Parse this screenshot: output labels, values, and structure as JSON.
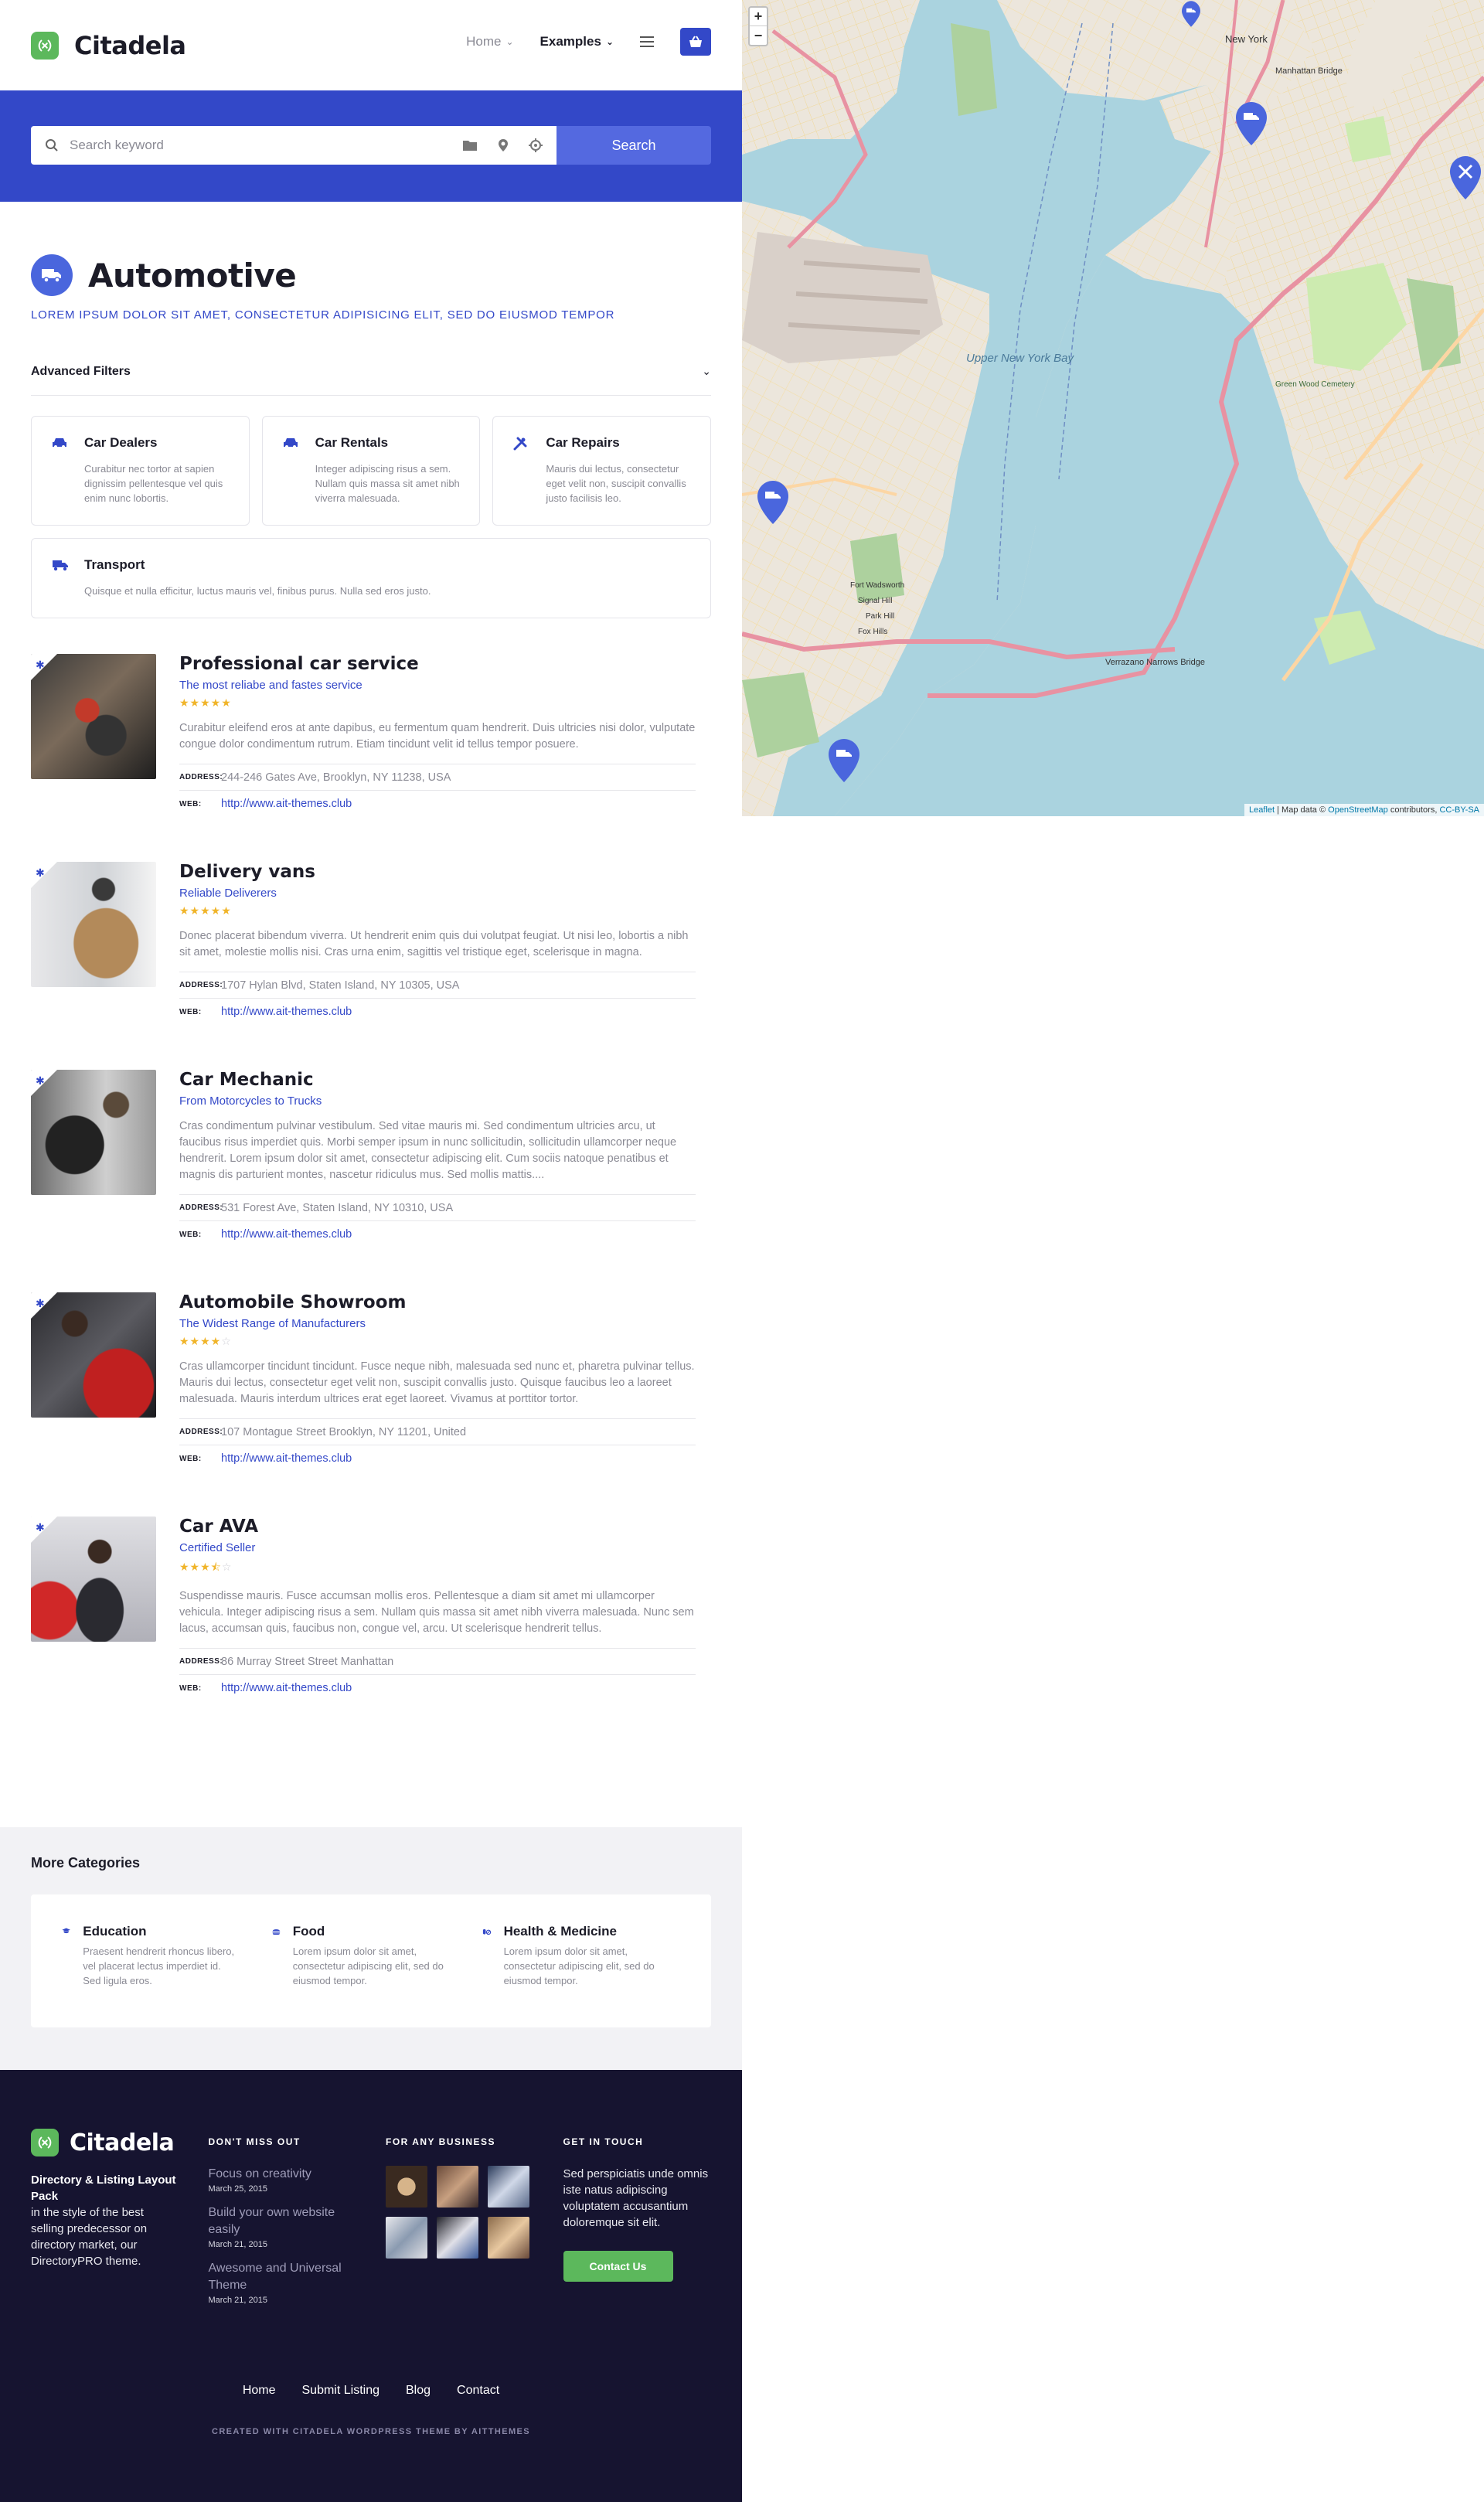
{
  "site": {
    "name": "Citadela"
  },
  "nav": {
    "home": "Home",
    "examples": "Examples"
  },
  "search": {
    "placeholder": "Search keyword",
    "button": "Search"
  },
  "category": {
    "title": "Automotive",
    "subtitle": "LOREM IPSUM DOLOR SIT AMET, CONSECTETUR ADIPISICING ELIT, SED DO EIUSMOD TEMPOR"
  },
  "filters": {
    "label": "Advanced Filters"
  },
  "subcategories": [
    {
      "title": "Car Dealers",
      "desc": "Curabitur nec tortor at sapien dignissim pellentesque vel quis enim nunc lobortis.",
      "icon": "car-icon"
    },
    {
      "title": "Car Rentals",
      "desc": "Integer adipiscing risus a sem. Nullam quis massa sit amet nibh viverra malesuada.",
      "icon": "car-icon"
    },
    {
      "title": "Car Repairs",
      "desc": "Mauris dui lectus, consectetur eget velit non, suscipit convallis justo facilisis leo.",
      "icon": "tools-icon"
    },
    {
      "title": "Transport",
      "desc": "Quisque et nulla efficitur, luctus mauris vel, finibus purus. Nulla sed eros justo.",
      "icon": "truck-icon"
    }
  ],
  "listings": [
    {
      "title": "Professional car service",
      "subtitle": "The most reliabe and fastes service",
      "rating": 5,
      "desc": "Curabitur eleifend eros at ante dapibus, eu fermentum quam hendrerit. Duis ultricies nisi dolor, vulputate congue dolor condimentum rutrum. Etiam tincidunt velit id tellus tempor posuere.",
      "address": "244-246 Gates Ave, Brooklyn, NY 11238, USA",
      "web": "http://www.ait-themes.club"
    },
    {
      "title": "Delivery vans",
      "subtitle": "Reliable Deliverers",
      "rating": 5,
      "desc": "Donec placerat bibendum viverra. Ut hendrerit enim quis dui volutpat feugiat. Ut nisi leo, lobortis a nibh sit amet, molestie mollis nisi. Cras urna enim, sagittis vel tristique eget, scelerisque in magna.",
      "address": "1707 Hylan Blvd, Staten Island, NY 10305, USA",
      "web": "http://www.ait-themes.club"
    },
    {
      "title": "Car Mechanic",
      "subtitle": "From Motorcycles to Trucks",
      "rating": 0,
      "desc": "Cras condimentum pulvinar vestibulum. Sed vitae mauris mi. Sed condimentum ultricies arcu, ut faucibus risus imperdiet quis. Morbi semper ipsum in nunc sollicitudin, sollicitudin ullamcorper neque hendrerit. Lorem ipsum dolor sit amet, consectetur adipiscing elit. Cum sociis natoque penatibus et magnis dis parturient montes, nascetur ridiculus mus. Sed mollis mattis....",
      "address": "531 Forest Ave, Staten Island, NY 10310, USA",
      "web": "http://www.ait-themes.club"
    },
    {
      "title": "Automobile Showroom",
      "subtitle": "The Widest Range of Manufacturers",
      "rating": 4,
      "desc": "Cras ullamcorper tincidunt tincidunt. Fusce neque nibh, malesuada sed nunc et, pharetra pulvinar tellus. Mauris dui lectus, consectetur eget velit non, suscipit convallis justo. Quisque faucibus leo a laoreet malesuada. Mauris interdum ultrices erat eget laoreet. Vivamus at porttitor tortor.",
      "address": "107 Montague Street Brooklyn, NY 11201, United",
      "web": "http://www.ait-themes.club"
    },
    {
      "title": "Car AVA",
      "subtitle": "Certified Seller",
      "rating": 3.5,
      "desc": "Suspendisse mauris. Fusce accumsan mollis eros. Pellentesque a diam sit amet mi ullamcorper vehicula. Integer adipiscing risus a sem. Nullam quis massa sit amet nibh viverra malesuada. Nunc sem lacus, accumsan quis, faucibus non, congue vel, arcu. Ut scelerisque hendrerit tellus.",
      "address": "86 Murray Street Street Manhattan",
      "web": "http://www.ait-themes.club"
    }
  ],
  "meta_labels": {
    "address": "ADDRESS:",
    "web": "WEB:"
  },
  "more": {
    "title": "More Categories",
    "items": [
      {
        "title": "Education",
        "desc": "Praesent hendrerit rhoncus libero, vel placerat lectus imperdiet id. Sed ligula eros.",
        "icon": "graduation-cap-icon"
      },
      {
        "title": "Food",
        "desc": "Lorem ipsum dolor sit amet, consectetur adipiscing elit, sed do eiusmod tempor.",
        "icon": "burger-icon"
      },
      {
        "title": "Health & Medicine",
        "desc": "Lorem ipsum dolor sit amet, consectetur adipiscing elit, sed do eiusmod tempor.",
        "icon": "pills-icon"
      }
    ]
  },
  "footer": {
    "about_strong": "Directory & Listing Layout Pack",
    "about": "in the style of the best selling predecessor on directory market, our DirectoryPRO theme.",
    "col2_title": "DON'T MISS OUT",
    "posts": [
      {
        "title": "Focus on creativity",
        "date": "March 25, 2015"
      },
      {
        "title": "Build your own website easily",
        "date": "March 21, 2015"
      },
      {
        "title": "Awesome and Universal Theme",
        "date": "March 21, 2015"
      }
    ],
    "col3_title": "FOR ANY BUSINESS",
    "col4_title": "GET IN TOUCH",
    "contact_text": "Sed perspiciatis unde omnis iste natus adipiscing voluptatem accusantium doloremque sit elit.",
    "contact_button": "Contact Us",
    "nav": [
      "Home",
      "Submit Listing",
      "Blog",
      "Contact"
    ],
    "copyright": "CREATED WITH CITADELA WORDPRESS THEME BY AITTHEMES"
  },
  "map": {
    "labels": [
      "New York",
      "Manhattan Bridge",
      "Upper New York Bay",
      "Green Wood Cemetery",
      "Verrazano Narrows Bridge",
      "Fort Wadsworth",
      "Signal Hill",
      "Park Hill",
      "Fox Hills"
    ],
    "attribution": {
      "leaflet": "Leaflet",
      "text": " | Map data © ",
      "osm": "OpenStreetMap",
      "contrib": " contributors, ",
      "license": "CC-BY-SA"
    },
    "markers": [
      "truck-icon",
      "truck-icon",
      "tools-icon",
      "truck-icon",
      "truck-icon"
    ]
  },
  "colors": {
    "accent": "#3348c8",
    "green": "#5cb85c",
    "footer_bg": "#161430",
    "star": "#f0b429"
  }
}
